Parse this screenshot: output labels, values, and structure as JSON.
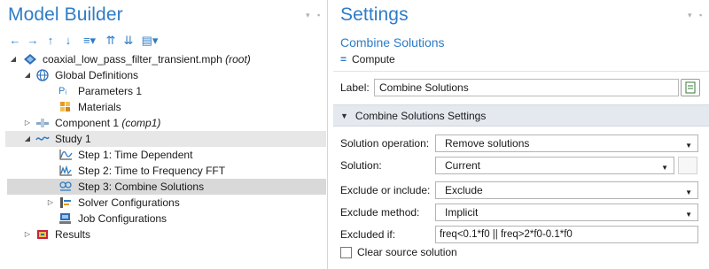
{
  "model_builder": {
    "title": "Model Builder",
    "menu_icon": "pin-menu-icon",
    "toolbar": [
      {
        "name": "back-arrow-icon",
        "glyph": "←"
      },
      {
        "name": "forward-arrow-icon",
        "glyph": "→"
      },
      {
        "name": "move-up-icon",
        "glyph": "↑"
      },
      {
        "name": "move-down-icon",
        "glyph": "↓"
      },
      {
        "name": "show-menu-icon",
        "glyph": "≡▾"
      },
      {
        "name": "expand-sections-icon",
        "glyph": "⇈"
      },
      {
        "name": "collapse-sections-icon",
        "glyph": "⇊"
      },
      {
        "name": "view-menu-icon",
        "glyph": "▤▾"
      }
    ],
    "tree": {
      "root": {
        "label": "coaxial_low_pass_filter_transient.mph",
        "tag": "(root)"
      },
      "global_definitions": "Global Definitions",
      "parameters": "Parameters 1",
      "parameters_icon_text": "Pᵢ",
      "materials": "Materials",
      "component": {
        "label": "Component 1",
        "tag": "(comp1)"
      },
      "study": "Study 1",
      "step1": "Step 1: Time Dependent",
      "step2": "Step 2: Time to Frequency FFT",
      "step3": "Step 3: Combine Solutions",
      "solver": "Solver Configurations",
      "jobs": "Job Configurations",
      "results": "Results"
    }
  },
  "settings": {
    "title": "Settings",
    "subtitle": "Combine Solutions",
    "compute_label": "Compute",
    "label_key": "Label:",
    "label_value": "Combine Solutions",
    "section_title": "Combine Solutions Settings",
    "fields": {
      "solution_operation": {
        "key": "Solution operation:",
        "value": "Remove solutions"
      },
      "solution": {
        "key": "Solution:",
        "value": "Current"
      },
      "exclude_or_include": {
        "key": "Exclude or include:",
        "value": "Exclude"
      },
      "exclude_method": {
        "key": "Exclude method:",
        "value": "Implicit"
      },
      "excluded_if": {
        "key": "Excluded if:",
        "value": "freq<0.1*f0 || freq>2*f0-0.1*f0"
      }
    },
    "clear_source_label": "Clear source solution",
    "clear_source_checked": false
  },
  "colors": {
    "accent": "#2e7cc6",
    "selection": "#d9d9d9",
    "section_bg": "#e4e8ef"
  }
}
